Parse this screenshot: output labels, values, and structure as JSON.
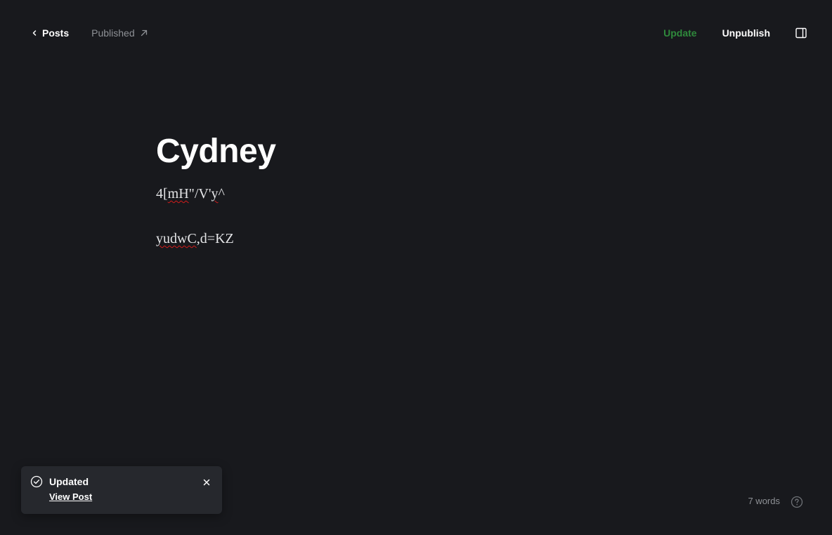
{
  "header": {
    "back_label": "Posts",
    "status_label": "Published",
    "update_label": "Update",
    "unpublish_label": "Unpublish"
  },
  "post": {
    "title": "Cydney",
    "paragraph_1": {
      "segments": [
        "4[",
        "mH",
        "\"/V'",
        "y",
        "^"
      ]
    },
    "paragraph_2": {
      "segments": [
        "yudwC",
        ",d=KZ"
      ]
    }
  },
  "toast": {
    "title": "Updated",
    "link_label": "View Post"
  },
  "footer": {
    "word_count": "7 words"
  },
  "colors": {
    "background": "#18191d",
    "accent_update": "#2f8a3c",
    "muted_text": "#8e9196",
    "toast_bg": "#26282d",
    "spellcheck": "#d21b1b"
  },
  "icons": {
    "back": "chevron-left-icon",
    "status": "arrow-up-right-icon",
    "sidebar": "sidebar-toggle-icon",
    "toast_status": "check-circle-icon",
    "toast_close": "close-icon",
    "help": "help-circle-icon"
  }
}
